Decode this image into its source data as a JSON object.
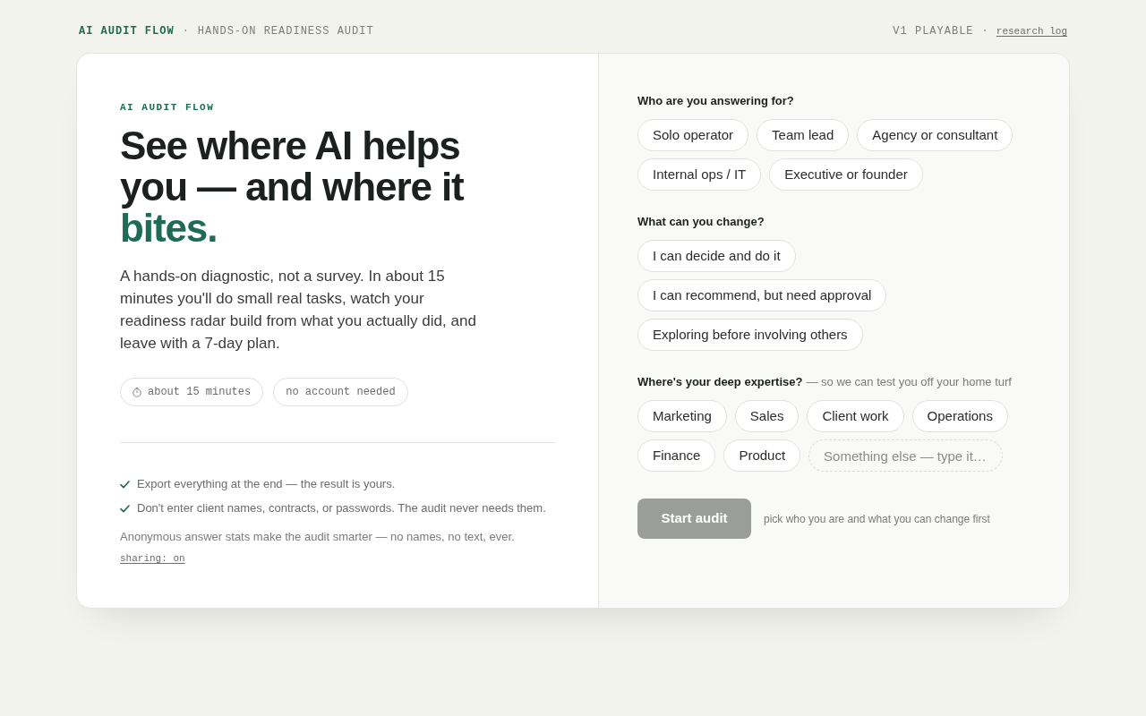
{
  "header": {
    "brand": "AI AUDIT FLOW",
    "separator": "·",
    "subtitle": "HANDS-ON READINESS AUDIT",
    "version": "V1 PLAYABLE",
    "separator_2": "·",
    "link": "research log"
  },
  "intro": {
    "eyebrow": "AI AUDIT FLOW",
    "headline": "See where AI helps you — and where it",
    "headline_highlight": "bites.",
    "description": "A hands-on diagnostic, not a survey. In about 15 minutes you'll do small real tasks, watch your readiness radar build from what you actually did, and leave with a 7-day plan.",
    "pills": [
      {
        "kind": "time",
        "label": "about 15 minutes"
      },
      {
        "kind": "plain",
        "label": "no account needed"
      }
    ],
    "assurances": [
      "Export everything at the end — the result is yours.",
      "Don't enter client names, contracts, or passwords. The audit never needs them."
    ],
    "privacy_note": "Anonymous answer stats make the audit smarter — no names, no text, ever.",
    "sharing_link": "sharing: on"
  },
  "questions": [
    {
      "label": "Who are you answering for?",
      "options": [
        {
          "label": "Solo operator",
          "selected": false
        },
        {
          "label": "Team lead",
          "selected": false
        },
        {
          "label": "Agency or consultant",
          "selected": false
        },
        {
          "label": "Internal ops / IT",
          "selected": false
        },
        {
          "label": "Executive or founder",
          "selected": false
        }
      ]
    },
    {
      "label": "What can you change?",
      "options": [
        {
          "label": "I can decide and do it",
          "selected": false
        },
        {
          "label": "I can recommend, but need approval",
          "selected": false
        },
        {
          "label": "Exploring before involving others",
          "selected": false
        }
      ]
    },
    {
      "label": "Where's your deep expertise?",
      "note": "— so we can test you off your home turf",
      "options": [
        {
          "label": "Marketing",
          "selected": false
        },
        {
          "label": "Sales",
          "selected": false
        },
        {
          "label": "Client work",
          "selected": false
        },
        {
          "label": "Operations",
          "selected": false
        },
        {
          "label": "Finance",
          "selected": false
        },
        {
          "label": "Product",
          "selected": false
        }
      ],
      "other_field": {
        "placeholder": "Something else — type it…"
      }
    }
  ],
  "start_button": {
    "label": "Start audit",
    "disabled": true
  },
  "start_hint": "pick who you are and what you can change first"
}
